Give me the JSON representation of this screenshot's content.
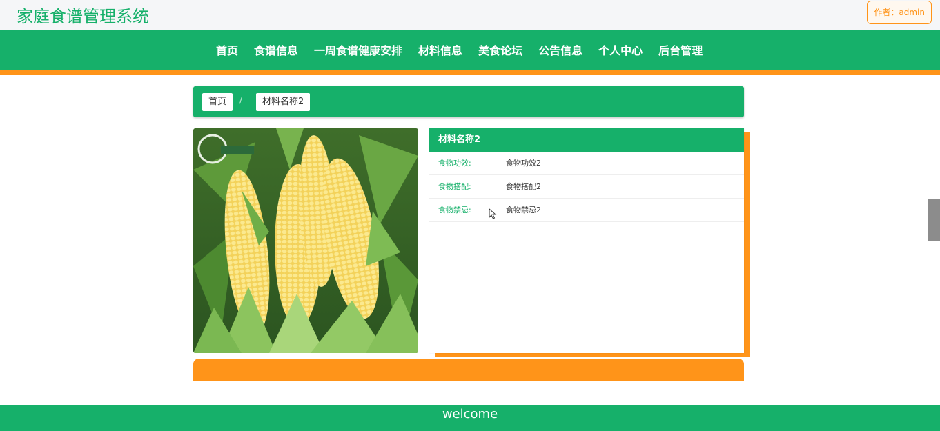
{
  "header": {
    "site_title": "家庭食谱管理系统",
    "author_badge": "作者：admin"
  },
  "nav": {
    "items": [
      "首页",
      "食谱信息",
      "一周食谱健康安排",
      "材料信息",
      "美食论坛",
      "公告信息",
      "个人中心",
      "后台管理"
    ]
  },
  "breadcrumb": {
    "home": "首页",
    "separator": "/",
    "current": "材料名称2"
  },
  "detail": {
    "title": "材料名称2",
    "rows": [
      {
        "label": "食物功效:",
        "value": "食物功效2"
      },
      {
        "label": "食物搭配:",
        "value": "食物搭配2"
      },
      {
        "label": "食物禁忌:",
        "value": "食物禁忌2"
      }
    ]
  },
  "image": {
    "icon": "corn-photo"
  },
  "footer": {
    "text": "welcome"
  },
  "colors": {
    "primary": "#16b06a",
    "accent": "#ff9419"
  }
}
